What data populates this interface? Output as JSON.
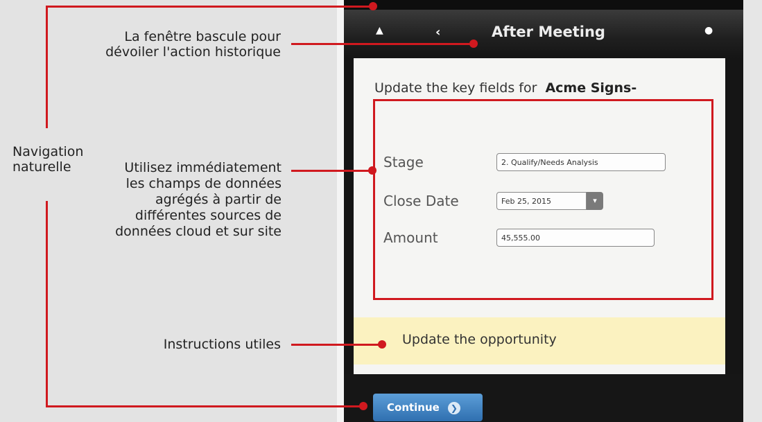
{
  "annotations": {
    "toggle_window": [
      "La fenêtre bascule pour",
      "dévoiler l'action historique"
    ],
    "natural_navigation": [
      "Navigation",
      "naturelle"
    ],
    "data_fields": [
      "Utilisez immédiatement",
      "les champs de données",
      "agrégés à partir de",
      "différentes sources de",
      "données cloud et sur site"
    ],
    "useful_instructions": "Instructions utiles"
  },
  "navbar": {
    "home_icon": "home-icon",
    "back_icon": "chevron-left-icon",
    "title": "After Meeting",
    "settings_icon": "gear-icon"
  },
  "content": {
    "heading_prefix": "Update the key fields for",
    "heading_account": "Acme Signs-",
    "fields": {
      "stage": {
        "label": "Stage",
        "value": "2. Qualify/Needs Analysis"
      },
      "close_date": {
        "label": "Close Date",
        "value": "Feb 25, 2015"
      },
      "amount": {
        "label": "Amount",
        "value": "45,555.00"
      }
    },
    "tip_text": "Update the opportunity"
  },
  "bottom": {
    "continue_label": "Continue",
    "continue_icon": "chevron-right-icon"
  },
  "colors": {
    "accent_red": "#d0191f",
    "tip_yellow": "#fbf2c0",
    "button_blue": "#3a7fc0"
  }
}
